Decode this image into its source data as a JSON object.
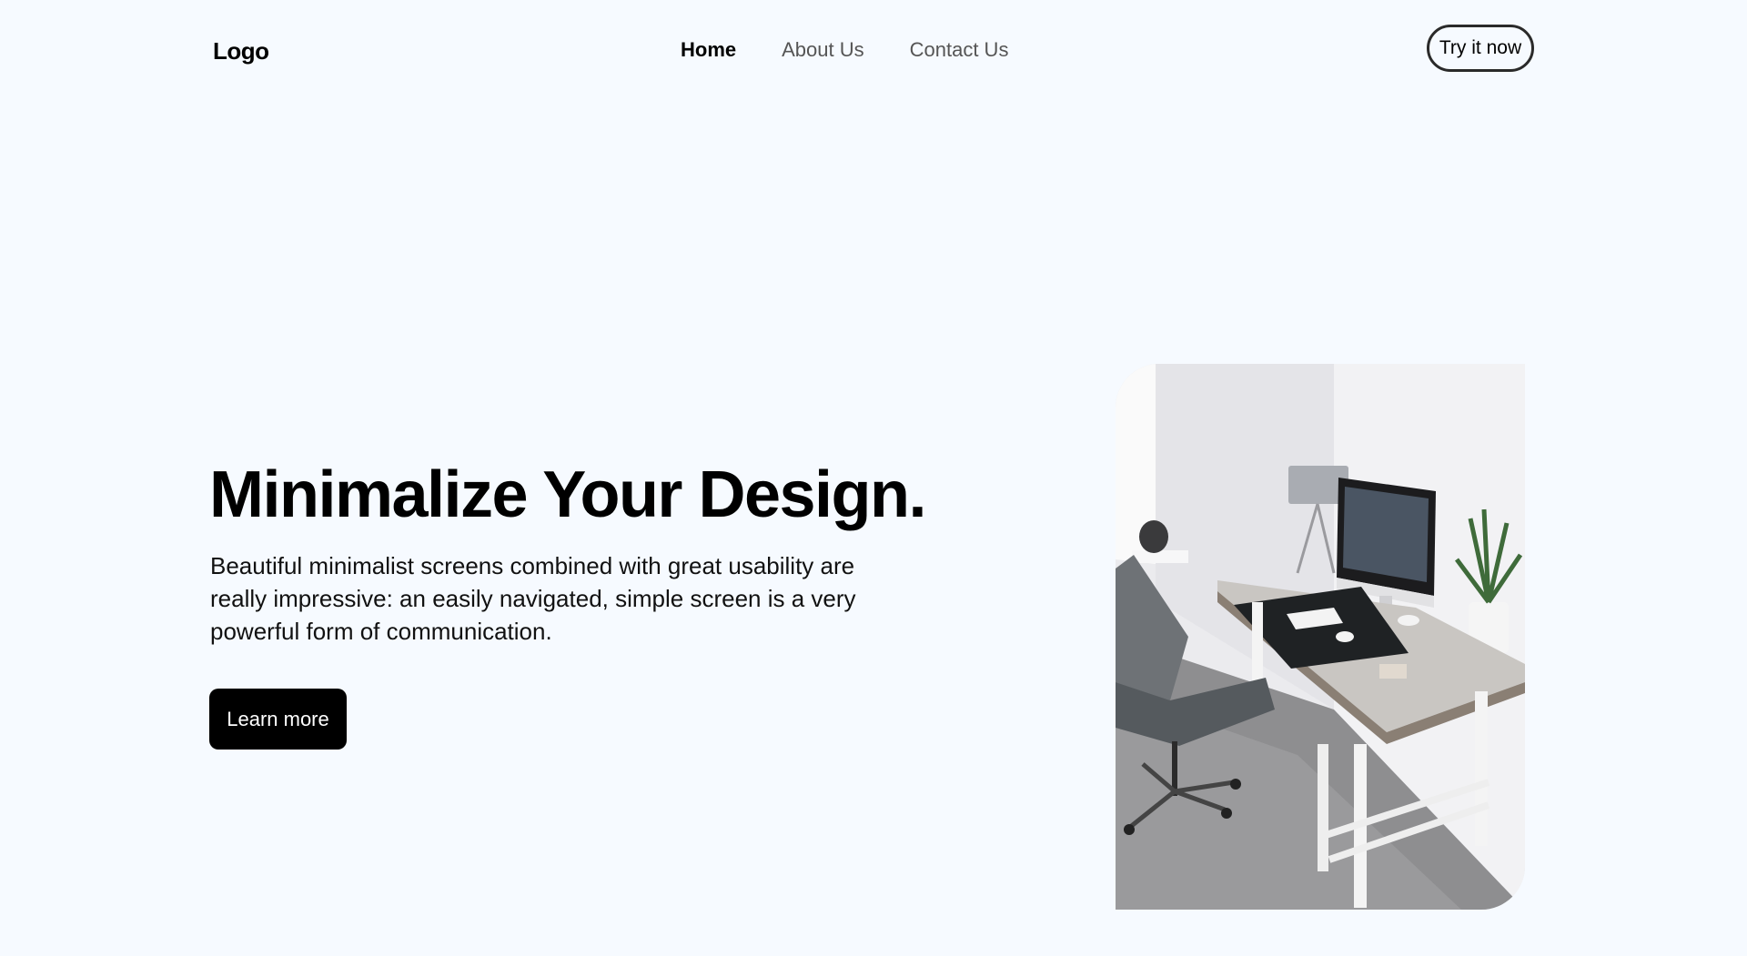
{
  "header": {
    "logo": "Logo",
    "nav": [
      {
        "label": "Home",
        "active": true
      },
      {
        "label": "About Us",
        "active": false
      },
      {
        "label": "Contact Us",
        "active": false
      }
    ],
    "cta_label": "Try it now"
  },
  "hero": {
    "title": "Minimalize Your Design.",
    "description": "Beautiful minimalist screens combined with great usability are really impressive: an easily navigated, simple screen is a very powerful form of communication.",
    "button_label": "Learn more",
    "image": "photo of a minimalist white desk with an iMac, lamp, plant and grey office chair"
  },
  "colors": {
    "background": "#f6faff",
    "text": "#000000",
    "nav_inactive": "#555555",
    "button_dark": "#000000"
  }
}
